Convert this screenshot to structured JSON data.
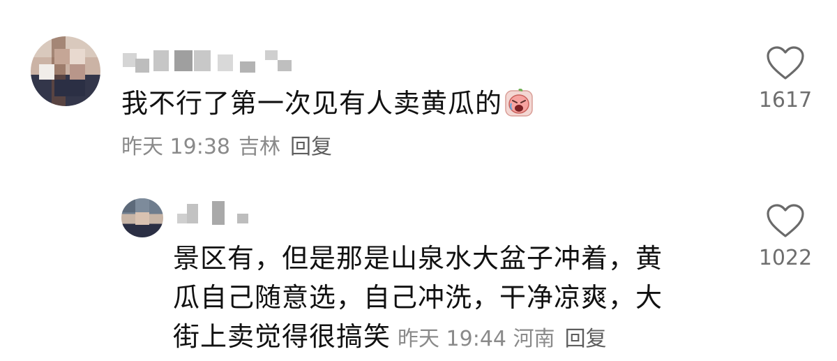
{
  "comment": {
    "text": "我不行了第一次见有人卖黄瓜的",
    "emoji_icon": "crying-face-sticker-icon",
    "time": "昨天 19:38",
    "location": "吉林",
    "reply_label": "回复",
    "likes": "1617"
  },
  "reply": {
    "line1": "景区有，但是那是山泉水大盆子冲着，黄",
    "line2": "瓜自己随意选，自己冲洗，干净凉爽，大",
    "line3": "街上卖觉得很搞笑",
    "time": "昨天 19:44",
    "location": "河南",
    "reply_label": "回复",
    "likes": "1022"
  },
  "icons": {
    "like": "heart-outline-icon"
  },
  "colors": {
    "text": "#111111",
    "meta": "#8a8a8a",
    "like_count": "#6e6e6e"
  }
}
